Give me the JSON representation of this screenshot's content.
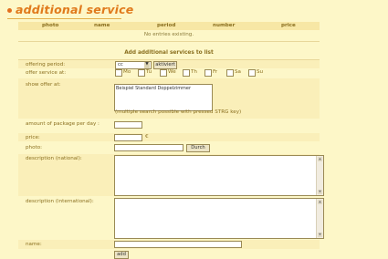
{
  "title": "additional service",
  "columns": [
    "photo",
    "name",
    "period",
    "number",
    "price"
  ],
  "no_entries": "No entries existing.",
  "section_title": "Add additional services to list",
  "offering_period": {
    "label": "offering period:",
    "value": "cc",
    "button": "aktiviert"
  },
  "offer_service_at": {
    "label": "offer service at:",
    "days": [
      "Mo",
      "Tu",
      "We",
      "Th",
      "Fr",
      "Sa",
      "Su"
    ]
  },
  "show_offer_at": {
    "label": "show offer at:",
    "option": "Beispiel Standard Doppelzimmer",
    "hint": "(multiple search possible with pressed STRG key)"
  },
  "amount_per_day": {
    "label": "amount of package per day :"
  },
  "price": {
    "label": "price:",
    "currency": "€"
  },
  "photo": {
    "label": "photo:",
    "button": "Durch"
  },
  "desc_national": {
    "label": "description (national):"
  },
  "desc_international": {
    "label": "description (international):"
  },
  "name": {
    "label": "name:"
  },
  "add_button": "add"
}
